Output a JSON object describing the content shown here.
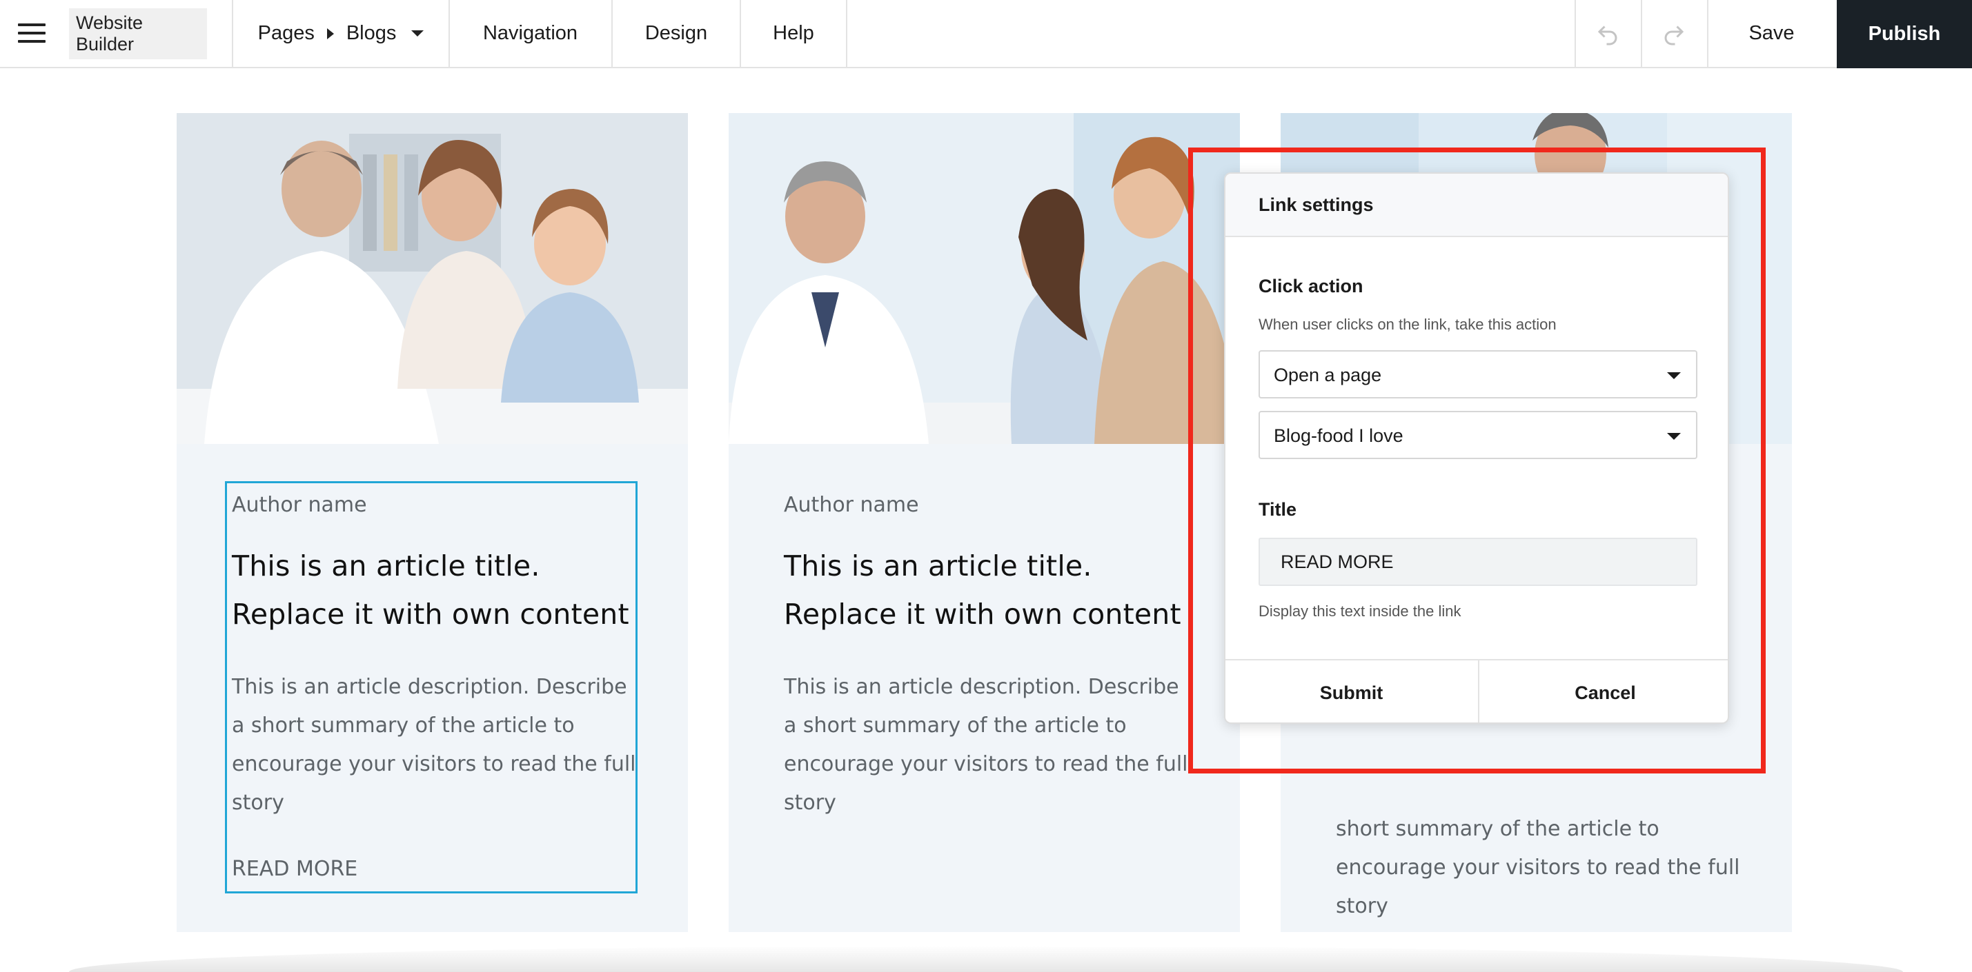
{
  "toolbar": {
    "app_name": "Website Builder",
    "breadcrumb_root": "Pages",
    "breadcrumb_current": "Blogs",
    "nav_label": "Navigation",
    "design_label": "Design",
    "help_label": "Help",
    "save_label": "Save",
    "publish_label": "Publish"
  },
  "cards": [
    {
      "author": "Author name",
      "title": "This is an article title. Replace it with own content",
      "description": "This is an article description. Describe a short summary of the article to encourage your visitors to read the full story",
      "read_more": "READ MORE"
    },
    {
      "author": "Author name",
      "title": "This is an article title. Replace it with own content",
      "description": "This is an article description. Describe a short summary of the article to encourage your visitors to read the full story"
    },
    {
      "description": "short summary of the article to encourage your visitors to read the full story"
    }
  ],
  "link_settings": {
    "title": "Link settings",
    "click_action_label": "Click action",
    "click_action_hint": "When user clicks on the link, take this action",
    "action_value": "Open a page",
    "page_value": "Blog-food I love",
    "title_label": "Title",
    "title_value": "READ MORE",
    "title_hint": "Display this text inside the link",
    "submit_label": "Submit",
    "cancel_label": "Cancel"
  },
  "colors": {
    "publish_bg": "#1a2127",
    "highlight": "#f0281c",
    "selection": "#21a6d6",
    "card_bg": "#f1f5f9"
  },
  "icons": [
    "menu-icon",
    "chevron-right-icon",
    "caret-down-icon",
    "undo-icon",
    "redo-icon"
  ]
}
